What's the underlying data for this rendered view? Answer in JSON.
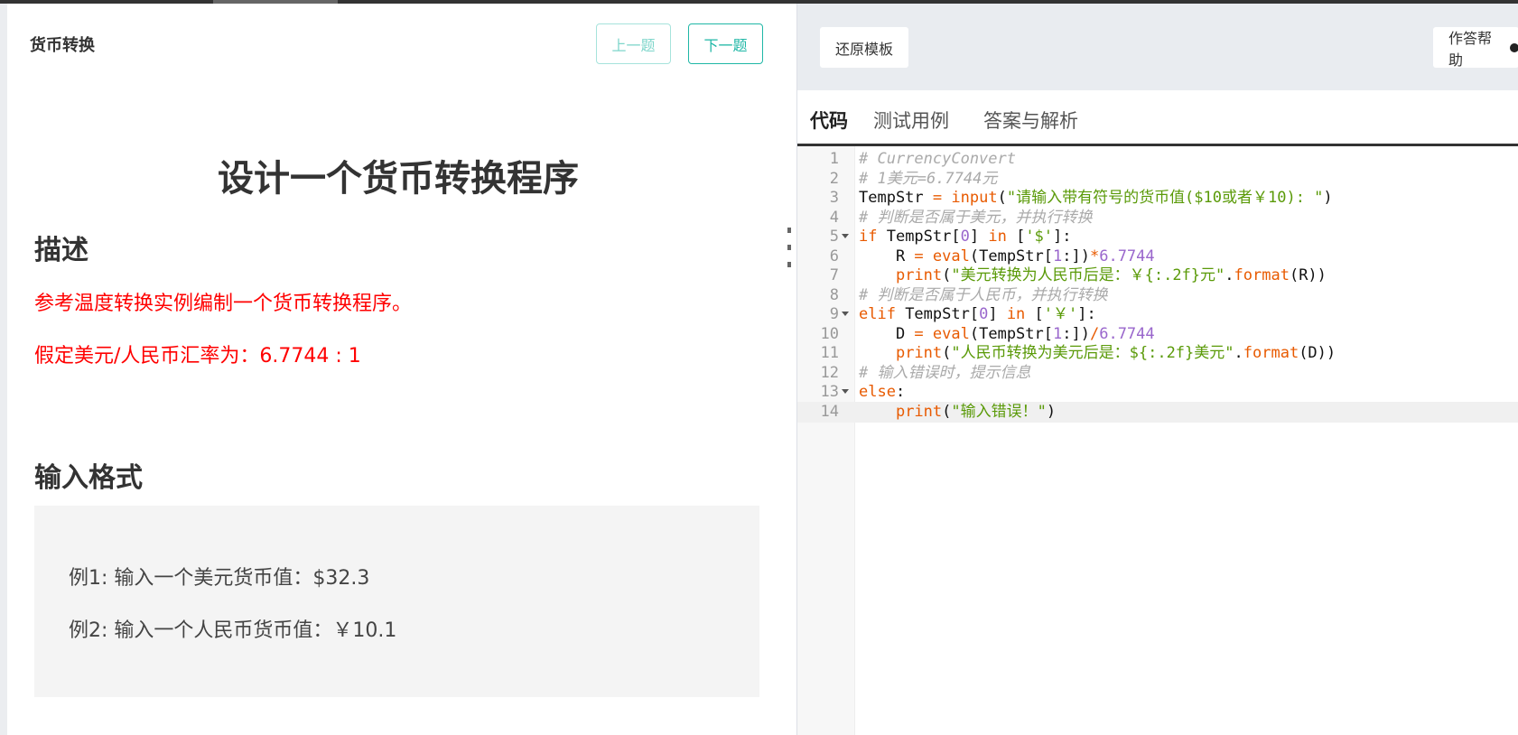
{
  "problem": {
    "title": "货币转换",
    "prev_label": "上一题",
    "next_label": "下一题",
    "heading": "设计一个货币转换程序",
    "desc_heading": "描述",
    "desc_lines": [
      "参考温度转换实例编制一个货币转换程序。",
      "假定美元/人民币汇率为：6.7744 : 1"
    ],
    "input_heading": "输入格式",
    "examples": [
      "例1: 输入一个美元货币值：$32.3",
      "例2: 输入一个人民币货币值：￥10.1"
    ]
  },
  "toolbar": {
    "reset_label": "还原模板",
    "help_label": "作答帮助"
  },
  "tabs": [
    "代码",
    "测试用例",
    "答案与解析"
  ],
  "colors": {
    "accent": "#1fb7a6",
    "desc_text": "#ff0000",
    "keyword": "#e85a00",
    "string": "#5a9a08",
    "number": "#9966cc",
    "comment": "#aaaaaa"
  },
  "code": [
    {
      "n": "1",
      "tokens": [
        [
          "comment",
          "# CurrencyConvert"
        ]
      ]
    },
    {
      "n": "2",
      "tokens": [
        [
          "comment",
          "# 1美元=6.7744元"
        ]
      ]
    },
    {
      "n": "3",
      "tokens": [
        [
          "plain",
          "TempStr "
        ],
        [
          "op",
          "="
        ],
        [
          "plain",
          " "
        ],
        [
          "keyword",
          "input"
        ],
        [
          "plain",
          "("
        ],
        [
          "string",
          "\"请输入带有符号的货币值($10或者￥10): \""
        ],
        [
          "plain",
          ")"
        ]
      ]
    },
    {
      "n": "4",
      "tokens": [
        [
          "comment",
          "# 判断是否属于美元，并执行转换"
        ]
      ]
    },
    {
      "n": "5",
      "fold": true,
      "tokens": [
        [
          "keyword",
          "if"
        ],
        [
          "plain",
          " TempStr["
        ],
        [
          "number",
          "0"
        ],
        [
          "plain",
          "] "
        ],
        [
          "keyword",
          "in"
        ],
        [
          "plain",
          " ["
        ],
        [
          "string",
          "'$'"
        ],
        [
          "plain",
          "]:"
        ]
      ]
    },
    {
      "n": "6",
      "tokens": [
        [
          "plain",
          "    R "
        ],
        [
          "op",
          "="
        ],
        [
          "plain",
          " "
        ],
        [
          "keyword",
          "eval"
        ],
        [
          "plain",
          "(TempStr["
        ],
        [
          "number",
          "1"
        ],
        [
          "plain",
          ":])"
        ],
        [
          "op",
          "*"
        ],
        [
          "number",
          "6.7744"
        ]
      ]
    },
    {
      "n": "7",
      "tokens": [
        [
          "plain",
          "    "
        ],
        [
          "keyword",
          "print"
        ],
        [
          "plain",
          "("
        ],
        [
          "string",
          "\"美元转换为人民币后是：￥{:.2f}元\""
        ],
        [
          "plain",
          "."
        ],
        [
          "keyword",
          "format"
        ],
        [
          "plain",
          "(R))"
        ]
      ]
    },
    {
      "n": "8",
      "tokens": [
        [
          "comment",
          "# 判断是否属于人民币，并执行转换"
        ]
      ]
    },
    {
      "n": "9",
      "fold": true,
      "tokens": [
        [
          "keyword",
          "elif"
        ],
        [
          "plain",
          " TempStr["
        ],
        [
          "number",
          "0"
        ],
        [
          "plain",
          "] "
        ],
        [
          "keyword",
          "in"
        ],
        [
          "plain",
          " ["
        ],
        [
          "string",
          "'￥'"
        ],
        [
          "plain",
          "]:"
        ]
      ]
    },
    {
      "n": "10",
      "tokens": [
        [
          "plain",
          "    D "
        ],
        [
          "op",
          "="
        ],
        [
          "plain",
          " "
        ],
        [
          "keyword",
          "eval"
        ],
        [
          "plain",
          "(TempStr["
        ],
        [
          "number",
          "1"
        ],
        [
          "plain",
          ":])"
        ],
        [
          "op",
          "/"
        ],
        [
          "number",
          "6.7744"
        ]
      ]
    },
    {
      "n": "11",
      "tokens": [
        [
          "plain",
          "    "
        ],
        [
          "keyword",
          "print"
        ],
        [
          "plain",
          "("
        ],
        [
          "string",
          "\"人民币转换为美元后是：${:.2f}美元\""
        ],
        [
          "plain",
          "."
        ],
        [
          "keyword",
          "format"
        ],
        [
          "plain",
          "(D))"
        ]
      ]
    },
    {
      "n": "12",
      "tokens": [
        [
          "comment",
          "# 输入错误时，提示信息"
        ]
      ]
    },
    {
      "n": "13",
      "fold": true,
      "tokens": [
        [
          "keyword",
          "else"
        ],
        [
          "plain",
          ":"
        ]
      ]
    },
    {
      "n": "14",
      "current": true,
      "tokens": [
        [
          "plain",
          "    "
        ],
        [
          "keyword",
          "print"
        ],
        [
          "plain",
          "("
        ],
        [
          "string",
          "\"输入错误！\""
        ],
        [
          "plain",
          ")"
        ]
      ]
    }
  ]
}
